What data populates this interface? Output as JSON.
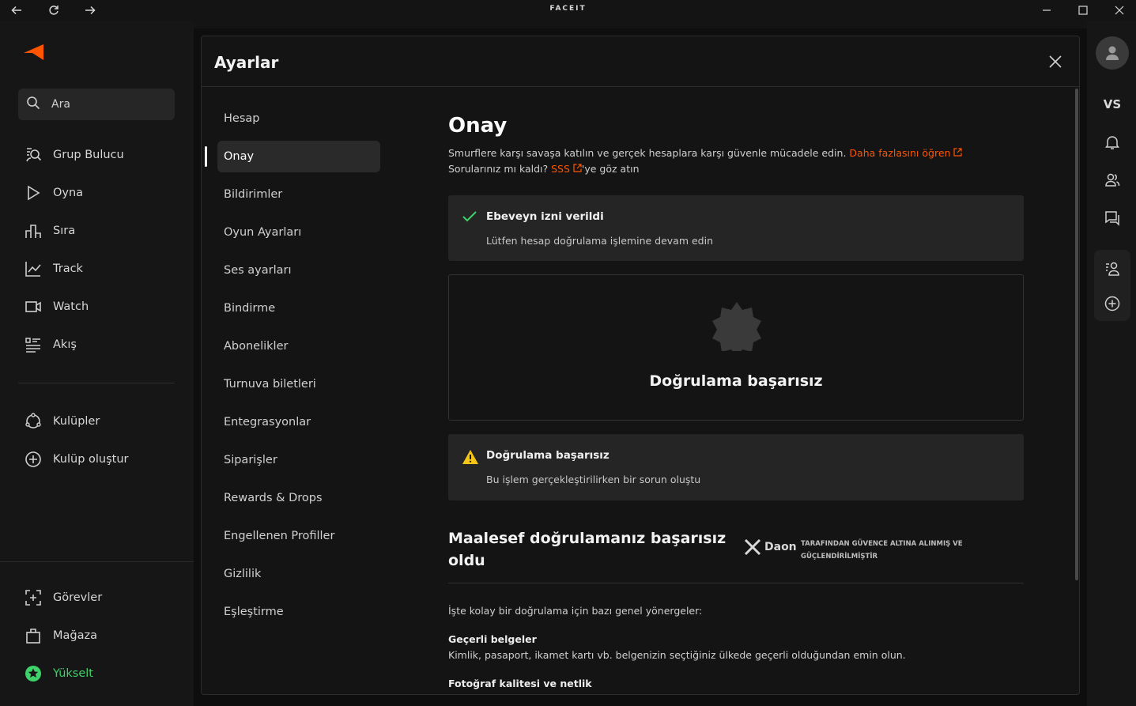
{
  "titlebar": {
    "title": "FACEIT"
  },
  "nav": {
    "search": "Ara",
    "items": [
      "Grup Bulucu",
      "Oyna",
      "Sıra",
      "Track",
      "Watch",
      "Akış"
    ],
    "clubs": [
      "Kulüpler",
      "Kulüp oluştur"
    ],
    "bottom": [
      "Görevler",
      "Mağaza",
      "Yükselt"
    ]
  },
  "rightrail": {
    "vs": "VS"
  },
  "colors": {
    "accent": "#ff5500",
    "success": "#3fd26a",
    "warning": "#f5c518",
    "upgrade": "#3fd26a"
  },
  "modal": {
    "title": "Ayarlar",
    "menu": [
      "Hesap",
      "Onay",
      "Bildirimler",
      "Oyun Ayarları",
      "Ses ayarları",
      "Bindirme",
      "Abonelikler",
      "Turnuva biletleri",
      "Entegrasyonlar",
      "Siparişler",
      "Rewards & Drops",
      "Engellenen Profiller",
      "Gizlilik",
      "Eşleştirme"
    ],
    "active_menu": "Onay"
  },
  "content": {
    "heading": "Onay",
    "desc_line1": "Smurflere karşı savaşa katılın ve gerçek hesaplara karşı güvenle mücadele edin.",
    "learn_more": "Daha fazlasını öğren",
    "desc_line2_prefix": "Sorularınız mı kaldı?",
    "faq": "SSS",
    "desc_line2_suffix": "'ye göz atın",
    "ok_title": "Ebeveyn izni verildi",
    "ok_sub": "Lütfen hesap doğrulama işlemine devam edin",
    "fail_title": "Doğrulama başarısız",
    "warn_title": "Doğrulama başarısız",
    "warn_sub": "Bu işlem gerçekleştirilirken bir sorun oluştu",
    "fail_heading": "Maalesef doğrulamanız başarısız oldu",
    "daon_brand": "Daon",
    "daon_note": "TARAFINDAN GÜVENCE ALTINA ALINMIŞ VE GÜÇLENDİRİLMİŞTİR",
    "guide_intro": "İşte kolay bir doğrulama için bazı genel yönergeler:",
    "sec1_title": "Geçerli belgeler",
    "sec1_desc": "Kimlik, pasaport, ikamet kartı vb. belgenizin seçtiğiniz ülkede geçerli olduğundan emin olun.",
    "sec2_title": "Fotoğraf kalitesi ve netlik"
  }
}
